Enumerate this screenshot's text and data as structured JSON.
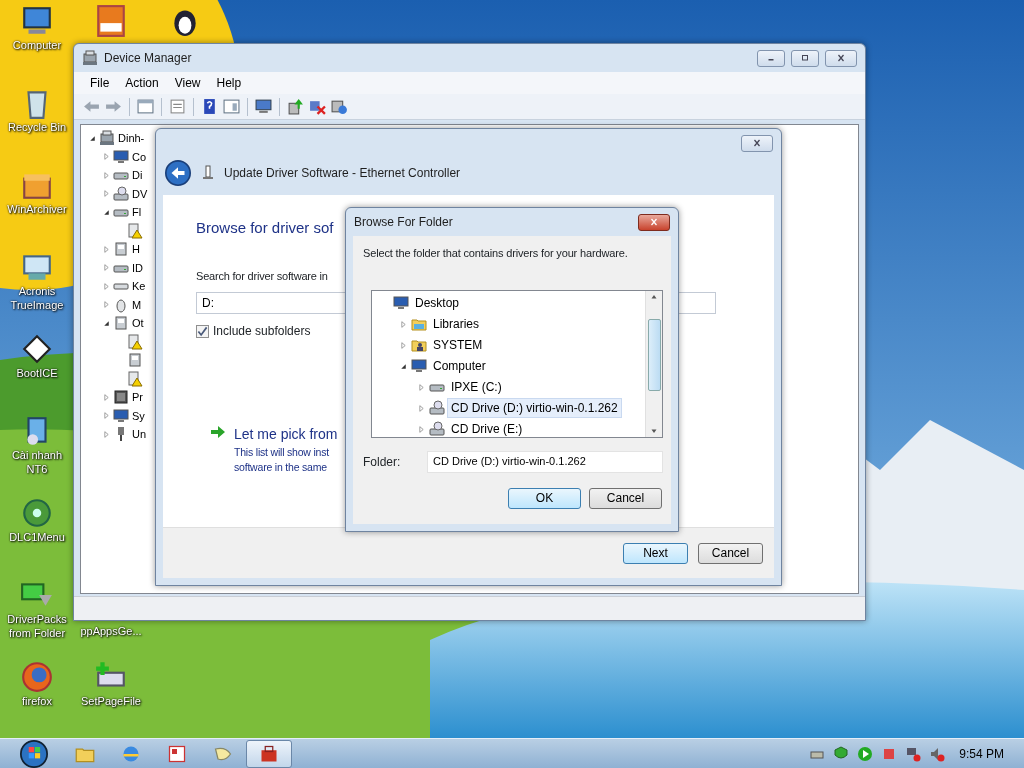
{
  "desktop_icons": [
    {
      "kind": "computer",
      "label": "Computer"
    },
    {
      "kind": "recycle",
      "label": "Recycle Bin"
    },
    {
      "kind": "archive",
      "label": "WinArchiver"
    },
    {
      "kind": "backup",
      "label": "Acronis TrueImage"
    },
    {
      "kind": "floppy",
      "label": "BootICE"
    },
    {
      "kind": "installer",
      "label": "Cài nhanh NT6"
    },
    {
      "kind": "disc",
      "label": "DLC1Menu"
    },
    {
      "kind": "pack",
      "label": "DriverPacks from Folder"
    },
    {
      "kind": "browser",
      "label": "firefox"
    },
    {
      "kind": "pdf"
    },
    {
      "kind": "penguin"
    },
    {
      "kind": "hidden",
      "label": "ppAppsGe..."
    },
    {
      "kind": "pagefile",
      "label": "SetPageFile"
    }
  ],
  "device_manager": {
    "title": "Device Manager",
    "menu": [
      "File",
      "Action",
      "View",
      "Help"
    ],
    "tree": [
      {
        "kind": "computer",
        "label": "Dinh-",
        "expanded": true,
        "children": [
          {
            "kind": "monitor",
            "label": "Co",
            "expanded": false
          },
          {
            "kind": "drive",
            "label": "Di",
            "expanded": false
          },
          {
            "kind": "cd",
            "label": "DV",
            "expanded": false
          },
          {
            "kind": "drive",
            "label": "Fl",
            "expanded": true,
            "children": [
              {
                "kind": "warning"
              }
            ]
          },
          {
            "kind": "device",
            "label": "H",
            "expanded": false
          },
          {
            "kind": "drive",
            "label": "ID",
            "expanded": false
          },
          {
            "kind": "keyboard",
            "label": "Ke",
            "expanded": false
          },
          {
            "kind": "mouse",
            "label": "M",
            "expanded": false
          },
          {
            "kind": "device",
            "label": "Ot",
            "expanded": true,
            "children": [
              {
                "kind": "warning"
              },
              {
                "kind": "device"
              },
              {
                "kind": "warning"
              }
            ]
          },
          {
            "kind": "chip",
            "label": "Pr",
            "expanded": false
          },
          {
            "kind": "monitor",
            "label": "Sy",
            "expanded": false
          },
          {
            "kind": "plug",
            "label": "Un",
            "expanded": false
          }
        ]
      }
    ]
  },
  "update_driver": {
    "title": "Update Driver Software - Ethernet Controller",
    "heading": "Browse for driver sof",
    "search_label": "Search for driver software in",
    "path": "D:",
    "include_subfolders": {
      "label": "Include subfolders",
      "checked": true
    },
    "pick_title": "Let me pick from",
    "pick_lines": [
      "This list will show inst",
      "software in the same"
    ],
    "buttons": [
      {
        "label": "Next",
        "default": true
      },
      {
        "label": "Cancel",
        "default": false
      }
    ]
  },
  "browse_folder": {
    "title": "Browse For Folder",
    "instruction": "Select the folder that contains drivers for your hardware.",
    "tree": [
      {
        "kind": "monitor",
        "label": "Desktop",
        "children": [
          {
            "kind": "folder",
            "label": "Libraries",
            "expanded": false,
            "selected": false
          },
          {
            "kind": "user",
            "label": "SYSTEM",
            "expanded": false,
            "selected": false
          },
          {
            "kind": "monitor",
            "label": "Computer",
            "expanded": true,
            "selected": false,
            "children": [
              {
                "kind": "drive",
                "label": "IPXE (C:)",
                "expanded": false,
                "selected": false
              },
              {
                "kind": "cd",
                "label": "CD Drive (D:) virtio-win-0.1.262",
                "expanded": false,
                "selected": true
              },
              {
                "kind": "cd",
                "label": "CD Drive (E:)",
                "expanded": false,
                "selected": false
              }
            ]
          }
        ],
        "selected": false
      }
    ],
    "folder_label": "Folder:",
    "folder_value": "CD Drive (D:) virtio-win-0.1.262",
    "buttons": [
      {
        "label": "OK",
        "default": true
      },
      {
        "label": "Cancel",
        "default": false
      }
    ]
  },
  "taskbar": {
    "items": [
      {
        "kind": "folder",
        "active": false
      },
      {
        "kind": "browser",
        "active": false
      },
      {
        "kind": "app",
        "active": false
      },
      {
        "kind": "bird",
        "active": false
      },
      {
        "kind": "toolbox",
        "active": true
      }
    ],
    "clock": "9:54 PM"
  }
}
